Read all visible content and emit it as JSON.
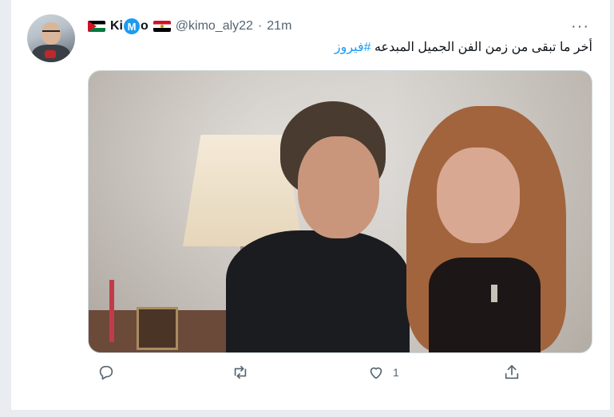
{
  "tweet": {
    "display_name": {
      "prefix": "Ki",
      "middle": "M",
      "suffix": "o"
    },
    "handle": "@kimo_aly22",
    "separator": "·",
    "time": "21m",
    "more_label": "···",
    "text": "أخر ما تبقى من زمن الفن الجميل المبدعه",
    "hashtag": "#فيروز",
    "like_count": "1"
  },
  "icons": {
    "flag_left": "jordan-flag-icon",
    "flag_right": "egypt-flag-icon",
    "reply": "reply-icon",
    "retweet": "retweet-icon",
    "like": "heart-icon",
    "share": "share-icon"
  },
  "colors": {
    "accent": "#1d9bf0",
    "text": "#0f1419",
    "muted": "#536471"
  }
}
